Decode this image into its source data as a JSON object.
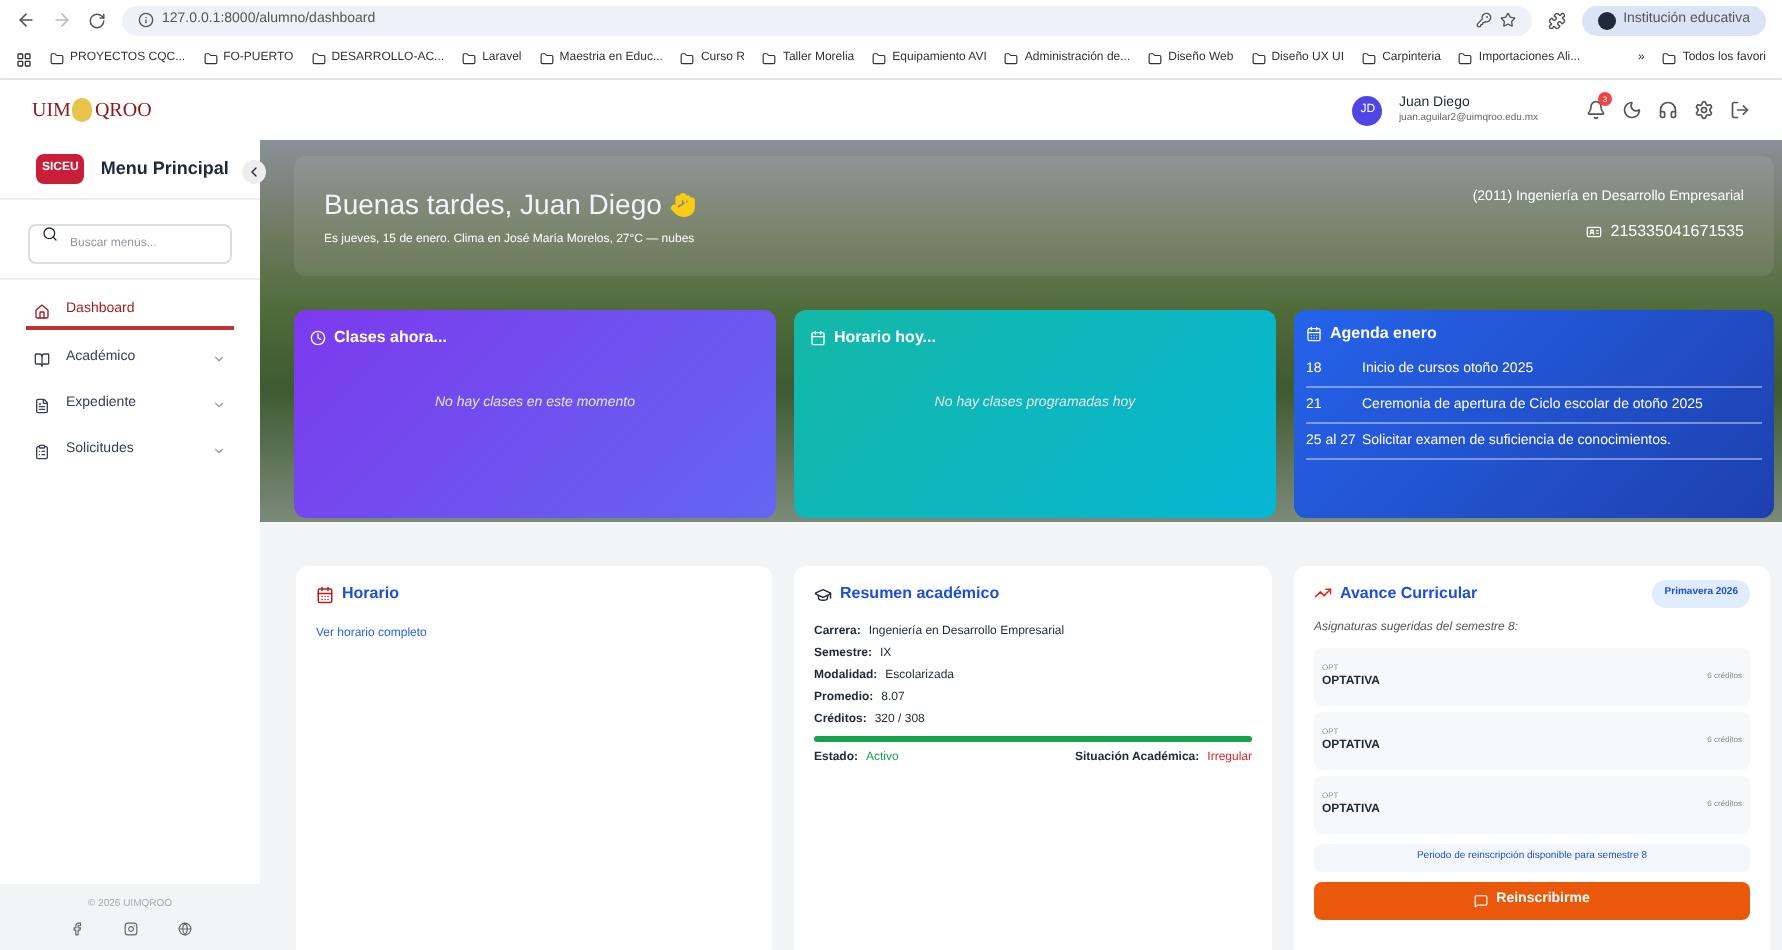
{
  "browser": {
    "url": "127.0.0.1:8000/alumno/dashboard",
    "profile_label": "Institución educativa",
    "bookmarks": [
      "PROYECTOS CQC...",
      "FO-PUERTO",
      "DESARROLLO-AC...",
      "Laravel",
      "Maestria en Educ...",
      "Curso R",
      "Taller Morelia",
      "Equipamiento AVI",
      "Administración de...",
      "Diseño Web",
      "Diseño UX UI",
      "Carpinteria",
      "Importaciones Ali..."
    ],
    "more": "»",
    "all_bookmarks": "Todos los favori"
  },
  "header": {
    "logo_left": "UIM",
    "logo_right": "QROO",
    "user": {
      "initials": "JD",
      "name": "Juan Diego",
      "email": "juan.aguilar2@uimqroo.edu.mx"
    },
    "notifications": "3"
  },
  "sidebar": {
    "badge": "SICEU",
    "title": "Menu Principal",
    "search_placeholder": "Buscar menús...",
    "items": [
      {
        "label": "Dashboard",
        "kind": "link",
        "selected": true
      },
      {
        "label": "Académico",
        "kind": "group",
        "selected": false
      },
      {
        "label": "Expediente",
        "kind": "group",
        "selected": false
      },
      {
        "label": "Solicitudes",
        "kind": "group",
        "selected": false
      }
    ],
    "footer": "© 2026 UIMQROO"
  },
  "hero": {
    "greeting": "Buenas tardes, Juan Diego",
    "subtitle": "Es jueves, 15 de enero.  Clima en José María Morelos, 27°C — nubes",
    "program": "(2011) Ingeniería en Desarrollo Empresarial",
    "student_id": "215335041671535",
    "cards": [
      {
        "kind": "classes",
        "title": "Clases ahora...",
        "empty": "No hay clases en este momento"
      },
      {
        "kind": "schedule",
        "title": "Horario hoy...",
        "empty": "No hay clases programadas hoy"
      }
    ],
    "agenda": {
      "title": "Agenda enero",
      "events": [
        {
          "date": "18",
          "text": "Inicio de cursos otoño 2025"
        },
        {
          "date": "21",
          "text": "Ceremonia de apertura de Ciclo escolar de otoño 2025"
        },
        {
          "date": "25 al 27",
          "text": "Solicitar examen de suficiencia de conocimientos."
        }
      ]
    }
  },
  "horario": {
    "title": "Horario",
    "link": "Ver horario completo"
  },
  "resumen": {
    "title": "Resumen académico",
    "fields": [
      {
        "label": "Carrera:",
        "value": "Ingeniería en Desarrollo Empresarial"
      },
      {
        "label": "Semestre:",
        "value": "IX"
      },
      {
        "label": "Modalidad:",
        "value": "Escolarizada"
      },
      {
        "label": "Promedio:",
        "value": "8.07"
      },
      {
        "label": "Créditos:",
        "value": "320 / 308"
      }
    ],
    "level": 1,
    "status": [
      {
        "label": "Estado:",
        "value": "Activo",
        "color": "#16a34a"
      },
      {
        "label": "Situación Académica:",
        "value": "Irregular",
        "color": "#dc2626"
      }
    ]
  },
  "avance": {
    "title": "Avance Curricular",
    "badge": "Primavera 2026",
    "subtitle": "Asignaturas sugeridas del semestre 8:",
    "subjects": [
      {
        "code": "OPT",
        "name": "OPTATIVA",
        "credits": "6 créditos"
      },
      {
        "code": "OPT",
        "name": "OPTATIVA",
        "credits": "6 créditos"
      },
      {
        "code": "OPT",
        "name": "OPTATIVA",
        "credits": "6 créditos"
      }
    ],
    "notice": "Periodo de reinscripción disponible para semestre 8",
    "button": "Reinscribirme"
  }
}
